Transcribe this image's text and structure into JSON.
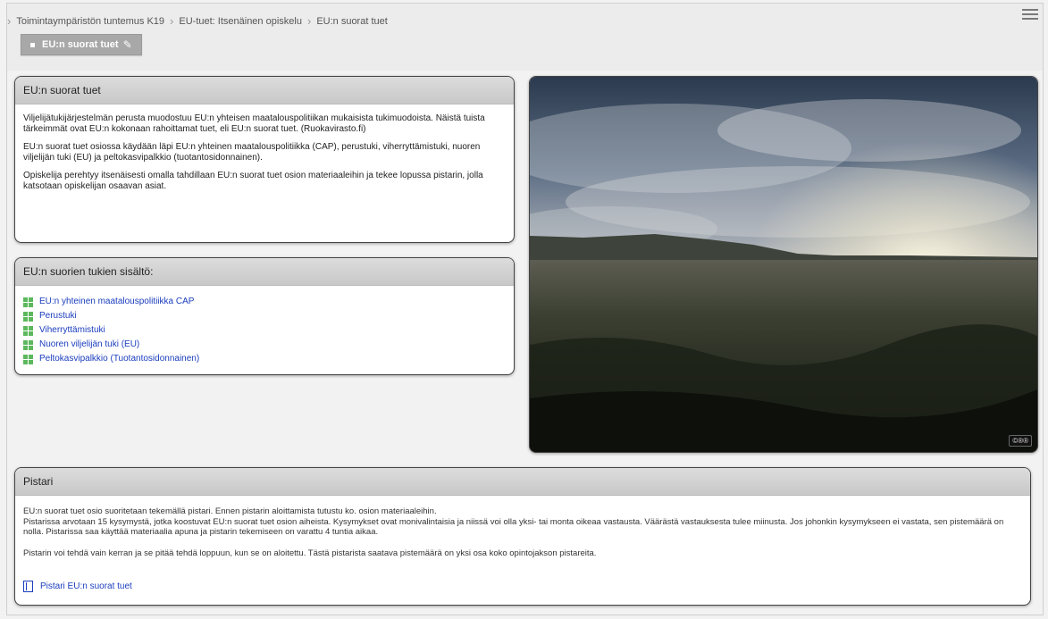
{
  "breadcrumb": {
    "items": [
      "Toimintaympäristön tuntemus K19",
      "EU-tuet: Itsenäinen opiskelu",
      "EU:n suorat tuet"
    ]
  },
  "page_tab": {
    "label": "EU:n suorat tuet"
  },
  "intro": {
    "title": "EU:n suorat tuet",
    "paragraphs": [
      "Viljelijätukijärjestelmän perusta muodostuu EU:n yhteisen maatalouspolitiikan mukaisista tukimuodoista. Näistä tuista tärkeimmät ovat EU:n kokonaan rahoittamat tuet, eli EU:n suorat tuet. (Ruokavirasto.fi)",
      "EU:n suorat tuet osiossa käydään läpi EU:n yhteinen maatalouspolitiikka (CAP), perustuki, viherryttämistuki, nuoren viljelijän tuki (EU) ja peltokasvipalkkio (tuotantosidonnainen).",
      "Opiskelija perehtyy itsenäisesti omalla tahdillaan EU:n suorat tuet osion materiaaleihin ja tekee lopussa pistarin, jolla katsotaan opiskelijan osaavan asiat."
    ]
  },
  "toc": {
    "title": "EU:n suorien tukien sisältö:",
    "items": [
      "EU:n yhteinen maatalouspolitiikka CAP",
      "Perustuki",
      "Viherryttämistuki",
      "Nuoren viljelijän tuki (EU)",
      "Peltokasvipalkkio (Tuotantosidonnainen)"
    ]
  },
  "photo": {
    "license_badge": "©®®"
  },
  "pistari": {
    "title": "Pistari",
    "lines": [
      "EU:n suorat tuet osio suoritetaan tekemällä pistari. Ennen pistarin aloittamista tutustu ko. osion materiaaleihin.",
      "Pistarissa arvotaan 15 kysymystä, jotka koostuvat EU:n suorat tuet osion aiheista. Kysymykset ovat monivalintaisia ja niissä voi olla yksi- tai monta oikeaa vastausta. Väärästä vastauksesta tulee miinusta. Jos johonkin kysymykseen ei vastata, sen pistemäärä on nolla. Pistarissa saa käyttää materiaalia apuna ja pistarin tekemiseen on varattu 4 tuntia aikaa.",
      "Pistarin voi tehdä vain kerran ja se pitää tehdä loppuun, kun se on aloitettu. Tästä pistarista saatava pistemäärä on yksi osa koko opintojakson pistareita."
    ],
    "link_label": "Pistari EU:n suorat tuet"
  },
  "colors": {
    "link": "#1a3dbd",
    "grid_icon": "#5cb85c",
    "tab_bg": "#a8a8a8"
  }
}
